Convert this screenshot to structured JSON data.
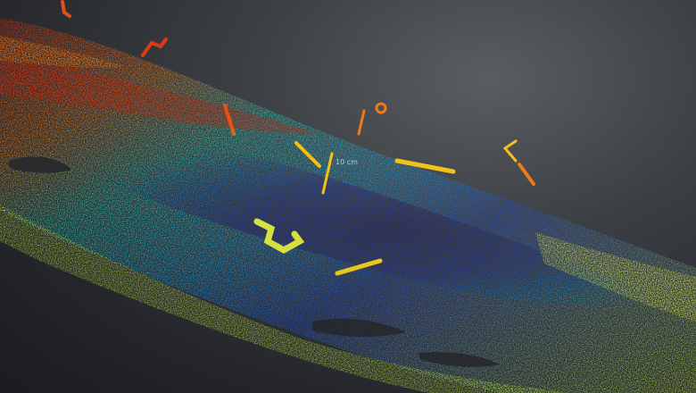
{
  "view": {
    "type": "point-cloud-depth-map",
    "colormap": [
      "#1a1f9a",
      "#1f4fd6",
      "#1aa0e0",
      "#2ad0b8",
      "#b8e040",
      "#f2c21a",
      "#f07a14",
      "#d62a10"
    ],
    "background": "#3c3f43"
  },
  "overlay": {
    "scale_text": "10 cm"
  }
}
